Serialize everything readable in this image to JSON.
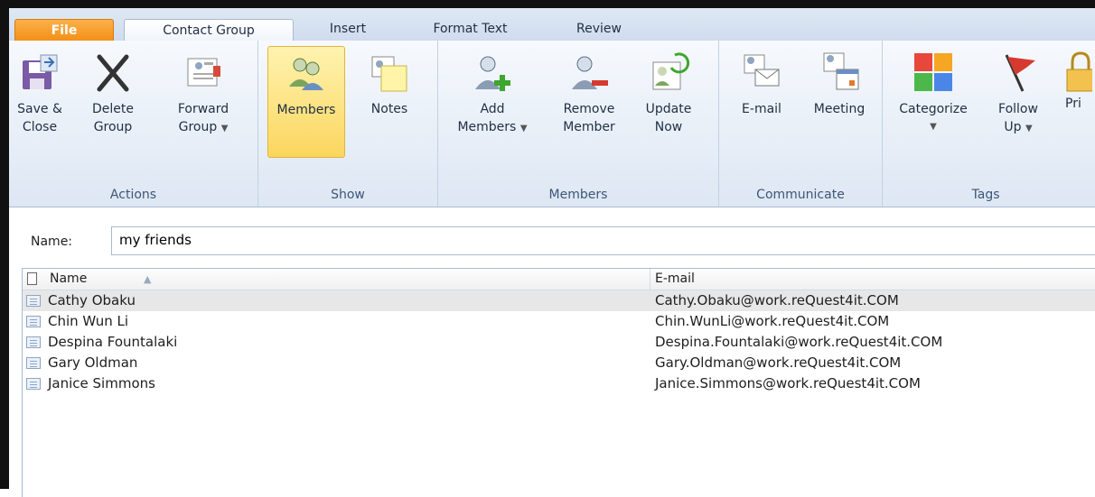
{
  "tabs": [
    "File",
    "Contact Group",
    "Insert",
    "Format Text",
    "Review"
  ],
  "ribbon": {
    "actions": {
      "label": "Actions",
      "save": [
        "Save &",
        "Close"
      ],
      "delete": [
        "Delete",
        "Group"
      ],
      "forward": [
        "Forward",
        "Group"
      ]
    },
    "show": {
      "label": "Show",
      "members": "Members",
      "notes": "Notes"
    },
    "members": {
      "label": "Members",
      "add": [
        "Add",
        "Members"
      ],
      "remove": [
        "Remove",
        "Member"
      ],
      "update": [
        "Update",
        "Now"
      ]
    },
    "communicate": {
      "label": "Communicate",
      "email": "E-mail",
      "meeting": "Meeting"
    },
    "tags": {
      "label": "Tags",
      "categorize": "Categorize",
      "follow": [
        "Follow",
        "Up"
      ],
      "private": "Pri"
    }
  },
  "name": {
    "label": "Name:",
    "value": "my friends"
  },
  "list": {
    "columns": [
      "Name",
      "E-mail"
    ],
    "rows": [
      {
        "name": "Cathy Obaku",
        "email": "Cathy.Obaku@work.reQuest4it.COM"
      },
      {
        "name": "Chin Wun Li",
        "email": "Chin.WunLi@work.reQuest4it.COM"
      },
      {
        "name": "Despina Fountalaki",
        "email": "Despina.Fountalaki@work.reQuest4it.COM"
      },
      {
        "name": "Gary Oldman",
        "email": "Gary.Oldman@work.reQuest4it.COM"
      },
      {
        "name": "Janice Simmons",
        "email": "Janice.Simmons@work.reQuest4it.COM"
      }
    ]
  },
  "colors": {
    "file_tab": "#f28c12",
    "selected_button": "#fbd65e",
    "ribbon_bg": "#dde7f3"
  }
}
